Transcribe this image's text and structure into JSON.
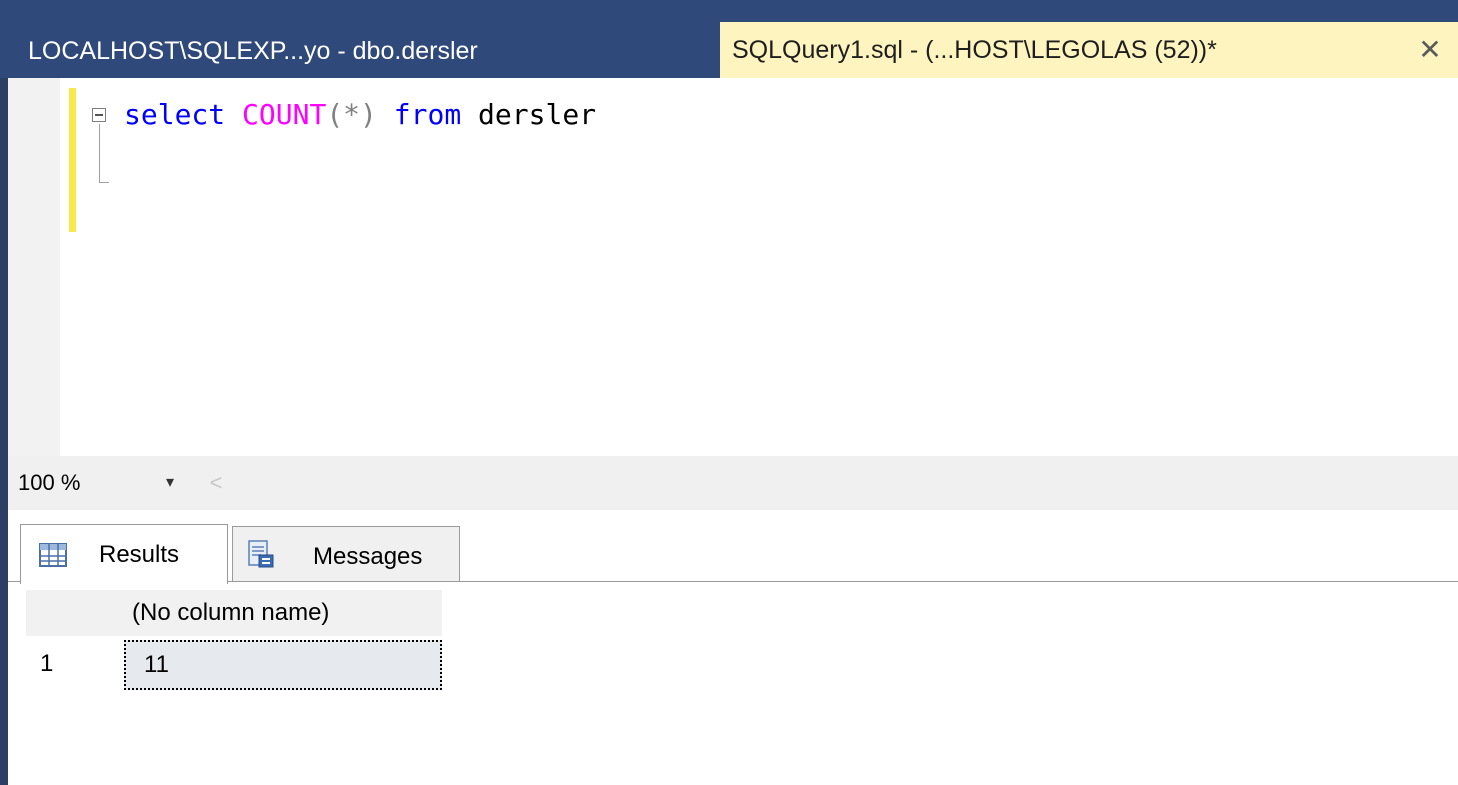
{
  "tabs": [
    {
      "label": "LOCALHOST\\SQLEXP...yo - dbo.dersler"
    },
    {
      "label": "SQLQuery1.sql - (...HOST\\LEGOLAS (52))*",
      "close": "✕"
    }
  ],
  "editor": {
    "tokens": {
      "select": "select",
      "count": "COUNT",
      "open_paren": "(",
      "star": "*",
      "close_paren": ")",
      "from": "from",
      "table": "dersler"
    }
  },
  "zoom": {
    "value": "100 %",
    "dropdown": "▾",
    "scroll": "<"
  },
  "results": {
    "tabs": [
      {
        "label": "Results",
        "icon": "grid-icon"
      },
      {
        "label": "Messages",
        "icon": "messages-icon"
      }
    ],
    "columns": [
      "(No column name)"
    ],
    "rows": [
      {
        "num": "1",
        "values": [
          "11"
        ]
      }
    ]
  },
  "colors": {
    "keyword": "#0000ff",
    "function": "#ff00ff",
    "operator": "#808080",
    "active_tab": "#fdf4bf",
    "change_bar": "#f7e94a"
  }
}
